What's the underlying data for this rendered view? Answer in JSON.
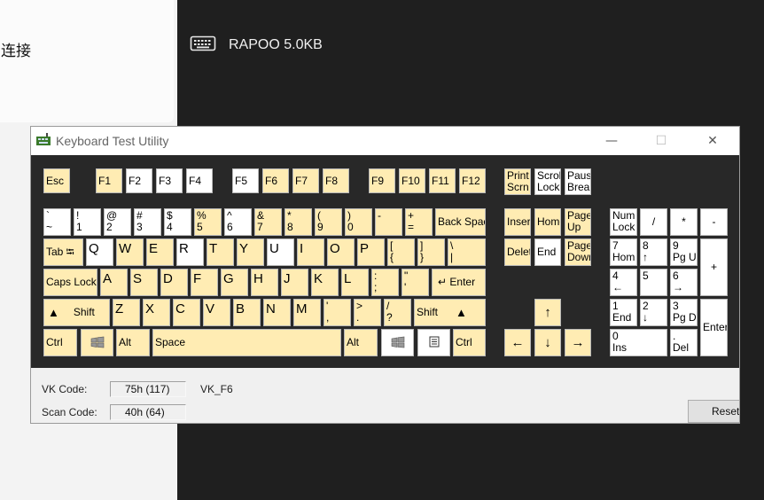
{
  "background": {
    "left_text": "中连接",
    "device_name": "RAPOO 5.0KB"
  },
  "window": {
    "title": "Keyboard Test Utility",
    "minimize": "—",
    "maximize": "☐",
    "close": "✕"
  },
  "info": {
    "vk_label": "VK Code:",
    "vk_value": "75h (117)",
    "vk_name": "VK_F6",
    "scan_label": "Scan Code:",
    "scan_value": "40h (64)",
    "reset_label": "Reset"
  },
  "keys": {
    "esc": "Esc",
    "f": [
      "F1",
      "F2",
      "F3",
      "F4",
      "F5",
      "F6",
      "F7",
      "F8",
      "F9",
      "F10",
      "F11",
      "F12"
    ],
    "print": [
      "Print",
      "Scrn"
    ],
    "scroll": [
      "Scrol",
      "Lock"
    ],
    "pause": [
      "Paus",
      "Brea"
    ],
    "num_row": [
      [
        "`",
        "~"
      ],
      [
        "!",
        "1"
      ],
      [
        "@",
        "2"
      ],
      [
        "#",
        "3"
      ],
      [
        "$",
        "4"
      ],
      [
        "%",
        "5"
      ],
      [
        "^",
        "6"
      ],
      [
        "&",
        "7"
      ],
      [
        "*",
        "8"
      ],
      [
        "(",
        "9"
      ],
      [
        ")",
        "0"
      ],
      [
        "",
        "-"
      ],
      [
        "+",
        "="
      ]
    ],
    "backspace": "Back Spac",
    "tab": "Tab ⭾",
    "q_row": [
      "Q",
      "W",
      "E",
      "R",
      "T",
      "Y",
      "U",
      "I",
      "O",
      "P"
    ],
    "bracket_l": [
      "[",
      "{"
    ],
    "bracket_r": [
      "]",
      "}"
    ],
    "backslash": [
      "\\",
      "|"
    ],
    "caps": "Caps Lock",
    "a_row": [
      "A",
      "S",
      "D",
      "F",
      "G",
      "H",
      "J",
      "K",
      "L"
    ],
    "semicolon": [
      ":",
      ";"
    ],
    "quote": [
      "\"",
      "'"
    ],
    "enter": "↵ Enter",
    "lshift": "Shift",
    "rshift": "Shift",
    "z_row": [
      "Z",
      "X",
      "C",
      "V",
      "B",
      "N",
      "M"
    ],
    "comma": [
      "'",
      ","
    ],
    "period": [
      ">",
      "."
    ],
    "slash": [
      "/",
      "?"
    ],
    "ctrl": "Ctrl",
    "alt": "Alt",
    "space": "Space",
    "insert": "Inser",
    "home": "Home",
    "pgup": [
      "Page",
      "Up"
    ],
    "delete": "Delete",
    "end": "End",
    "pgdn": [
      "Page",
      "Down"
    ],
    "up": "↑",
    "left": "←",
    "down": "↓",
    "right": "→",
    "numlock": [
      "Num",
      "Lock"
    ],
    "np_div": "/",
    "np_mul": "*",
    "np_sub": "-",
    "np_add": "+",
    "np7": [
      "7",
      "Hom"
    ],
    "np8": [
      "8",
      "↑"
    ],
    "np9": [
      "9",
      "Pg U"
    ],
    "np4": [
      "4",
      "←"
    ],
    "np5": [
      "5",
      ""
    ],
    "np6": [
      "6",
      "→"
    ],
    "np1": [
      "1",
      "End"
    ],
    "np2": [
      "2",
      "↓"
    ],
    "np3": [
      "3",
      "Pg D"
    ],
    "np0": [
      "0",
      "Ins"
    ],
    "np_dot": [
      ".",
      "Del"
    ],
    "np_enter": "Enter"
  }
}
